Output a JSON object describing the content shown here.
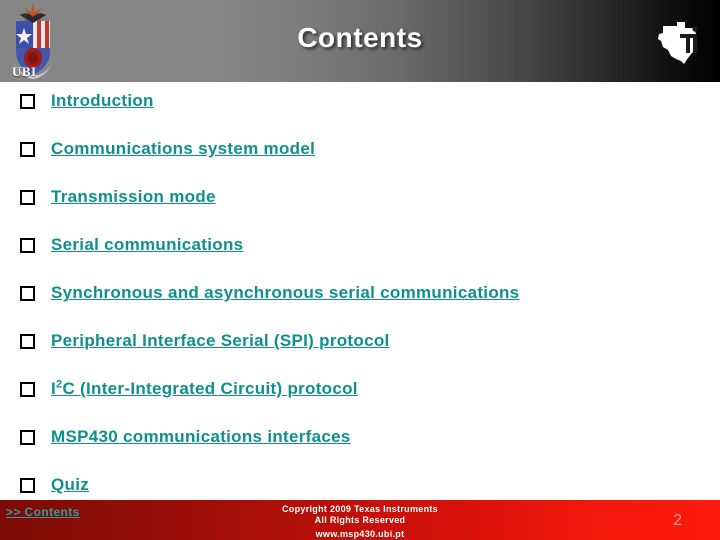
{
  "header": {
    "title": "Contents",
    "ubi_caption": "UBI",
    "ubi_logo_icon": "ubi-coat-of-arms-icon",
    "ti_logo_icon": "texas-instruments-logo-icon",
    "gradient_from": "#868686",
    "gradient_to": "#000000"
  },
  "contents": {
    "accent_color": "#0f8f8f",
    "bullet_icon": "hollow-square-bullet-icon",
    "items": [
      {
        "label": "Introduction"
      },
      {
        "label": "Communications system model"
      },
      {
        "label": "Transmission mode"
      },
      {
        "label": "Serial communications"
      },
      {
        "label": "Synchronous and asynchronous serial communications"
      },
      {
        "label": "Peripheral Interface Serial (SPI) protocol"
      },
      {
        "label_prefix": "I",
        "label_sup": "2",
        "label_suffix": "C (Inter-Integrated Circuit) protocol"
      },
      {
        "label": "MSP430 communications interfaces"
      },
      {
        "label": "Quiz"
      }
    ]
  },
  "footer": {
    "contents_link": ">> Contents",
    "copyright_line1": "Copyright 2009 Texas Instruments",
    "copyright_line2": "All Rights Reserved",
    "url": "www.msp430.ubi.pt",
    "page_number": "2",
    "gradient_from": "#7d0b06",
    "gradient_to": "#fe1a0d",
    "link_color": "#2f9c9c"
  }
}
